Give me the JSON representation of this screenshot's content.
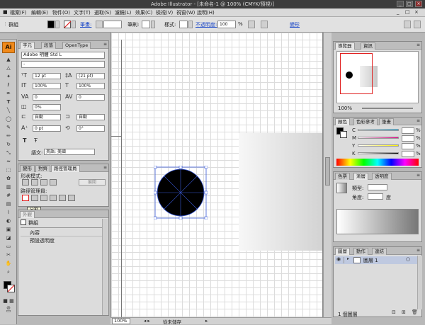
{
  "window": {
    "title": "Adobe Illustrator - [未命名-1 @ 100% (CMYK/預視)]",
    "controls": [
      "_",
      "□",
      "×"
    ]
  },
  "menu": {
    "items": [
      "檔案(F)",
      "編輯(E)",
      "物件(O)",
      "文字(T)",
      "選取(S)",
      "濾鏡(L)",
      "效果(C)",
      "檢視(V)",
      "視窗(W)",
      "說明(H)"
    ]
  },
  "control_bar": {
    "selection": "群組",
    "stroke_label": "筆畫:",
    "brush_label": "筆刷:",
    "style_label": "樣式:",
    "opacity_label": "不透明度:",
    "opacity_value": "100",
    "percent": "%",
    "transform_link": "變形"
  },
  "character_panel": {
    "tabs": [
      "字元",
      "段落",
      "OpenType"
    ],
    "font_family": "Adobe 明體 Std L",
    "font_style": "-",
    "font_size": "12 pt",
    "leading": "(21 pt)",
    "vscale": "100%",
    "hscale": "100%",
    "kerning": "0",
    "tracking": "0",
    "tsume": "0%",
    "aki_left": "自動",
    "aki_right": "自動",
    "baseline": "0 pt",
    "rotation": "0°",
    "language_label": "語文:",
    "language_value": "英語: 美國"
  },
  "pathfinder_panel": {
    "tabs": [
      "變形",
      "對齊",
      "路徑管理員"
    ],
    "shape_modes_label": "形狀模式:",
    "expand_label": "展開",
    "pathfinders_label": "路徑管理員:",
    "tooltip": "分割"
  },
  "appearance_panel": {
    "tab": "外觀",
    "group_label": "群組",
    "rows": [
      "內容",
      "預設透明度"
    ]
  },
  "navigator_panel": {
    "tabs": [
      "導覽器",
      "資訊"
    ],
    "zoom": "100%"
  },
  "color_panel": {
    "tabs": [
      "顏色",
      "色彩參考",
      "筆畫"
    ],
    "channels": [
      "C",
      "M",
      "Y",
      "K"
    ],
    "percent": "%"
  },
  "gradient_panel": {
    "tabs": [
      "色票",
      "漸層",
      "透明度"
    ],
    "type_label": "類型:",
    "angle_label": "角度:",
    "degree": "度"
  },
  "layers_panel": {
    "tabs": [
      "圖層",
      "動作",
      "連結"
    ],
    "layer_name": "圖層 1",
    "count": "1 個圖層"
  },
  "status": {
    "zoom": "100%",
    "info": "從未儲存"
  },
  "colors": {
    "accent_orange": "#f08a1c",
    "selection_blue": "#3a5ad8",
    "tooltip_red": "#e02020"
  }
}
